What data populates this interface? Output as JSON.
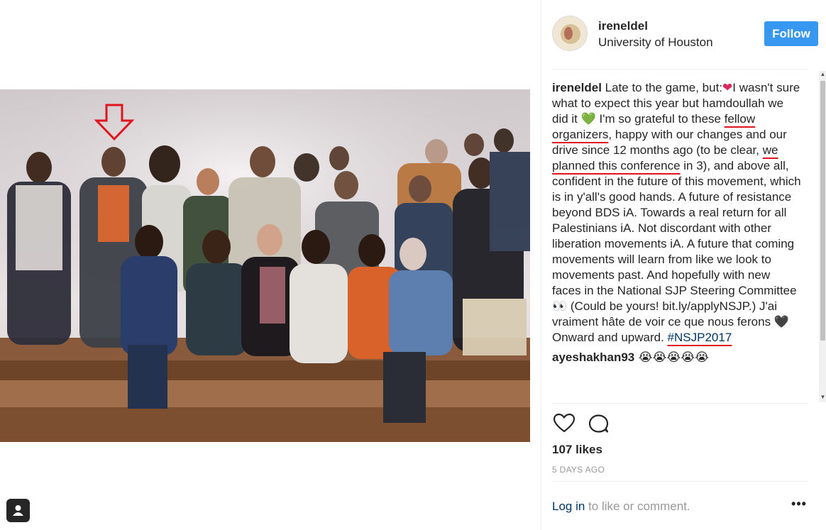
{
  "post": {
    "username": "ireneldel",
    "location": "University of Houston",
    "follow_label": "Follow"
  },
  "caption": {
    "author": "ireneldel",
    "t1": " Late to the game, but:",
    "e1": "❤",
    "t2": "I wasn't sure what to expect this year but hamdoullah we did it ",
    "e2": "💚",
    "t3": " I'm so grateful to these ",
    "h1": "fellow organizers",
    "t4": ", happy with our changes and our drive since 12 months ago (to be clear, ",
    "h2": "we planned this conference",
    "t5": " in 3), and above all, confident in the future of this movement, which is in y'all's good hands. A future of resistance beyond BDS iA. Towards a real return for all Palestinians iA. Not discordant with other liberation movements iA. A future that coming movements will learn from like we look to movements past. And hopefully with new faces in the National SJP Steering Committee ",
    "e3": "👀",
    "t6": " (Could be yours! bit.ly/applyNSJP.) J'ai vraiment hâte de voir ce que nous ferons ",
    "e4": "🖤",
    "t7": " Onward and upward. ",
    "hashtag": "#NSJP2017"
  },
  "comment2": {
    "author": "ayeshakhan93",
    "emojis": " 😭😭😭😭😭"
  },
  "icons": {
    "like": "heart-outline-icon",
    "comment": "speech-bubble-icon",
    "tag": "user-tag-icon",
    "more": "more-options-icon"
  },
  "likes_text": "107 likes",
  "time_text": "5 DAYS AGO",
  "footer": {
    "login_label": "Log in",
    "login_suffix": " to like or comment.",
    "more_label": "•••"
  },
  "colors": {
    "accent": "#3897f0",
    "link": "#003569",
    "annotation_red": "#e0141e"
  }
}
